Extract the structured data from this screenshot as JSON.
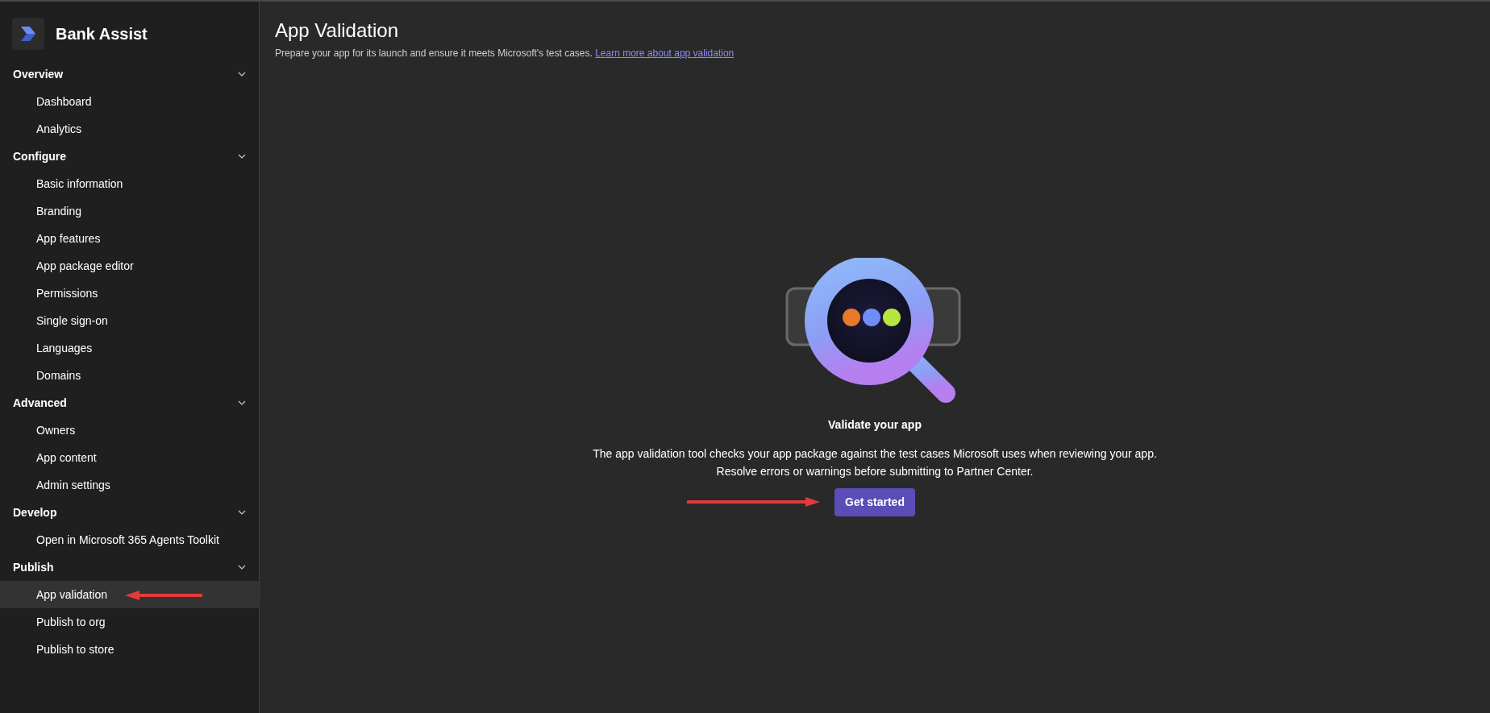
{
  "app": {
    "name": "Bank Assist"
  },
  "sidebar": {
    "sections": [
      {
        "label": "Overview",
        "expanded": true,
        "items": [
          {
            "label": "Dashboard",
            "selected": false
          },
          {
            "label": "Analytics",
            "selected": false
          }
        ]
      },
      {
        "label": "Configure",
        "expanded": true,
        "items": [
          {
            "label": "Basic information",
            "selected": false
          },
          {
            "label": "Branding",
            "selected": false
          },
          {
            "label": "App features",
            "selected": false
          },
          {
            "label": "App package editor",
            "selected": false
          },
          {
            "label": "Permissions",
            "selected": false
          },
          {
            "label": "Single sign-on",
            "selected": false
          },
          {
            "label": "Languages",
            "selected": false
          },
          {
            "label": "Domains",
            "selected": false
          }
        ]
      },
      {
        "label": "Advanced",
        "expanded": true,
        "items": [
          {
            "label": "Owners",
            "selected": false
          },
          {
            "label": "App content",
            "selected": false
          },
          {
            "label": "Admin settings",
            "selected": false
          }
        ]
      },
      {
        "label": "Develop",
        "expanded": true,
        "items": [
          {
            "label": "Open in Microsoft 365 Agents Toolkit",
            "selected": false
          }
        ]
      },
      {
        "label": "Publish",
        "expanded": true,
        "items": [
          {
            "label": "App validation",
            "selected": true
          },
          {
            "label": "Publish to org",
            "selected": false
          },
          {
            "label": "Publish to store",
            "selected": false
          }
        ]
      }
    ]
  },
  "page": {
    "title": "App Validation",
    "subtitle": "Prepare your app for its launch and ensure it meets Microsoft's test cases.",
    "link": "Learn more about app validation"
  },
  "empty_state": {
    "heading": "Validate your app",
    "description_lines": [
      "The app validation tool checks your app package against the test cases Microsoft uses when reviewing your app.",
      "Resolve errors or warnings before submitting to Partner Center."
    ],
    "button": "Get started"
  }
}
